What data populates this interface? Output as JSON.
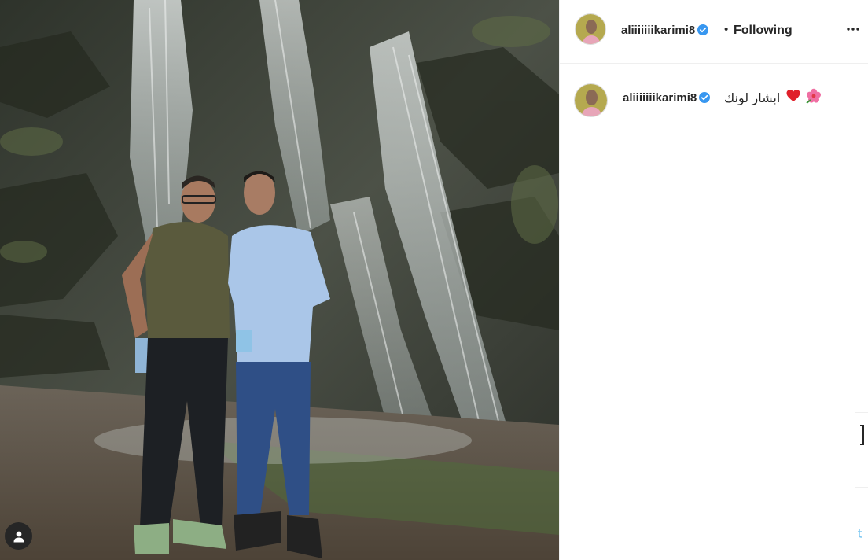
{
  "post": {
    "username": "aliiiiiiikarimi8",
    "verified": true,
    "follow_status": "Following",
    "separator": "•",
    "more_label": "More options"
  },
  "comment": {
    "username": "aliiiiiiikarimi8",
    "caption": "ابشار لونك",
    "emojis": [
      "red-heart-icon",
      "hibiscus-icon"
    ]
  },
  "colors": {
    "verified_blue": "#3897f0",
    "text": "#262626",
    "divider": "#efefef"
  }
}
